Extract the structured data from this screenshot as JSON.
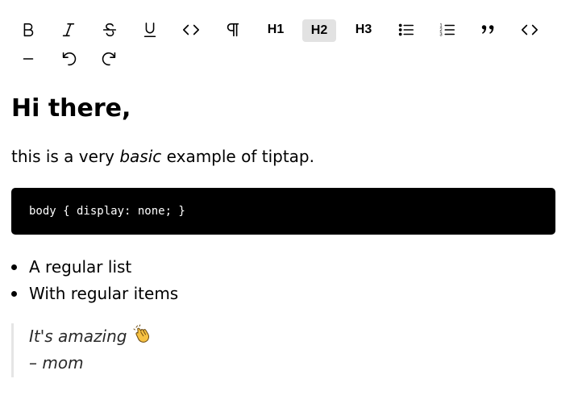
{
  "toolbar": {
    "buttons": [
      {
        "id": "bold",
        "icon": "bold-icon"
      },
      {
        "id": "italic",
        "icon": "italic-icon"
      },
      {
        "id": "strike",
        "icon": "strikethrough-icon"
      },
      {
        "id": "underline",
        "icon": "underline-icon"
      },
      {
        "id": "code",
        "icon": "code-icon"
      },
      {
        "id": "paragraph",
        "icon": "paragraph-icon"
      },
      {
        "id": "h1",
        "label": "H1"
      },
      {
        "id": "h2",
        "label": "H2",
        "active": true
      },
      {
        "id": "h3",
        "label": "H3"
      },
      {
        "id": "bullet-list",
        "icon": "bullet-list-icon"
      },
      {
        "id": "ordered-list",
        "icon": "ordered-list-icon"
      },
      {
        "id": "blockquote",
        "icon": "quote-icon"
      },
      {
        "id": "code-block",
        "icon": "code-block-icon"
      },
      {
        "id": "horizontal-rule",
        "icon": "horizontal-rule-icon"
      },
      {
        "id": "undo",
        "icon": "undo-icon"
      },
      {
        "id": "redo",
        "icon": "redo-icon"
      }
    ],
    "active_bg": "#e2e2e2"
  },
  "editor": {
    "heading": "Hi there,",
    "paragraph": {
      "before": "this is a very ",
      "emphasis": "basic",
      "after": " example of tiptap."
    },
    "code_block": "body { display: none; }",
    "list_items": [
      "A regular list",
      "With regular items"
    ],
    "blockquote": {
      "line1": "It's amazing",
      "emoji": "clapping-hands-icon",
      "line2": "– mom"
    },
    "code_bg": "#000000",
    "quote_border": "#e5e5e5"
  }
}
